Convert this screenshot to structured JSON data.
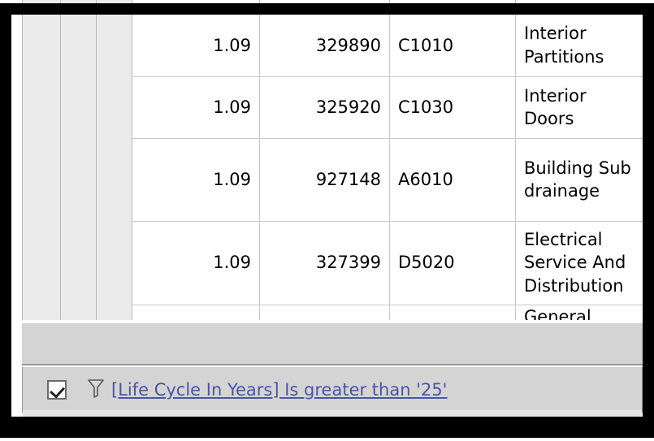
{
  "window": {
    "frame_color": "#000000",
    "client_background": "#ffffff"
  },
  "grid": {
    "name": "data-grid",
    "selector_columns": 3,
    "columns": [
      {
        "key": "factor",
        "align": "right"
      },
      {
        "key": "id",
        "align": "right"
      },
      {
        "key": "code",
        "align": "left"
      },
      {
        "key": "description",
        "align": "left"
      }
    ],
    "rows": [
      {
        "factor": "1.09",
        "id": "329890",
        "code": "C1010",
        "description": "Interior Partitions"
      },
      {
        "factor": "1.09",
        "id": "325920",
        "code": "C1030",
        "description": "Interior Doors"
      },
      {
        "factor": "1.09",
        "id": "927148",
        "code": "A6010",
        "description": "Building Sub drainage"
      },
      {
        "factor": "1.09",
        "id": "327399",
        "code": "D5020",
        "description": "Electrical Service And Distribution"
      }
    ],
    "clipped_row": {
      "factor": "",
      "id": "",
      "code": "",
      "description": "General"
    },
    "grid_line_color": "#c8c8c8",
    "selector_column_color": "#ebebeb",
    "footer_band_color": "#d4d4d4"
  },
  "filter_bar": {
    "name": "filter-bar",
    "enabled_checkbox": true,
    "icon": "funnel-icon",
    "expression": "[Life Cycle In Years] Is greater than '25'",
    "link_color": "#4a55a8",
    "background": "#d4d4d4"
  }
}
